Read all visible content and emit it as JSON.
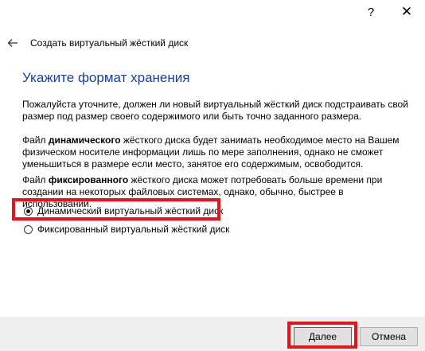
{
  "titlebar": {
    "help_label": "?",
    "close_label": "✕"
  },
  "nav": {
    "back_icon": "back-arrow-icon",
    "title": "Создать виртуальный жёсткий диск"
  },
  "content": {
    "heading": "Укажите формат хранения",
    "p1": "Пожалуйста уточните, должен ли новый виртуальный жёсткий диск подстраивать свой размер под размер своего содержимого или быть точно заданного размера.",
    "p2_prefix": "Файл ",
    "p2_bold": "динамического",
    "p2_suffix": " жёсткого диска будет занимать необходимое место на Вашем физическом носителе информации лишь по мере заполнения, однако не сможет уменьшиться в размере если место, занятое его содержимым, освободится.",
    "p3_prefix": "Файл ",
    "p3_bold": "фиксированного",
    "p3_suffix": " жёсткого диска может потребовать больше времени при создании на некоторых файловых системах, однако, обычно, быстрее в использовании."
  },
  "options": [
    {
      "label": "Динамический виртуальный жёсткий диск",
      "checked": true
    },
    {
      "label": "Фиксированный виртуальный жёсткий диск",
      "checked": false
    }
  ],
  "footer": {
    "next_label": "Далее",
    "cancel_label": "Отмена"
  },
  "colors": {
    "heading": "#1a3e9c",
    "highlight": "#e8141b",
    "footer_bg": "#f0f0f0"
  }
}
